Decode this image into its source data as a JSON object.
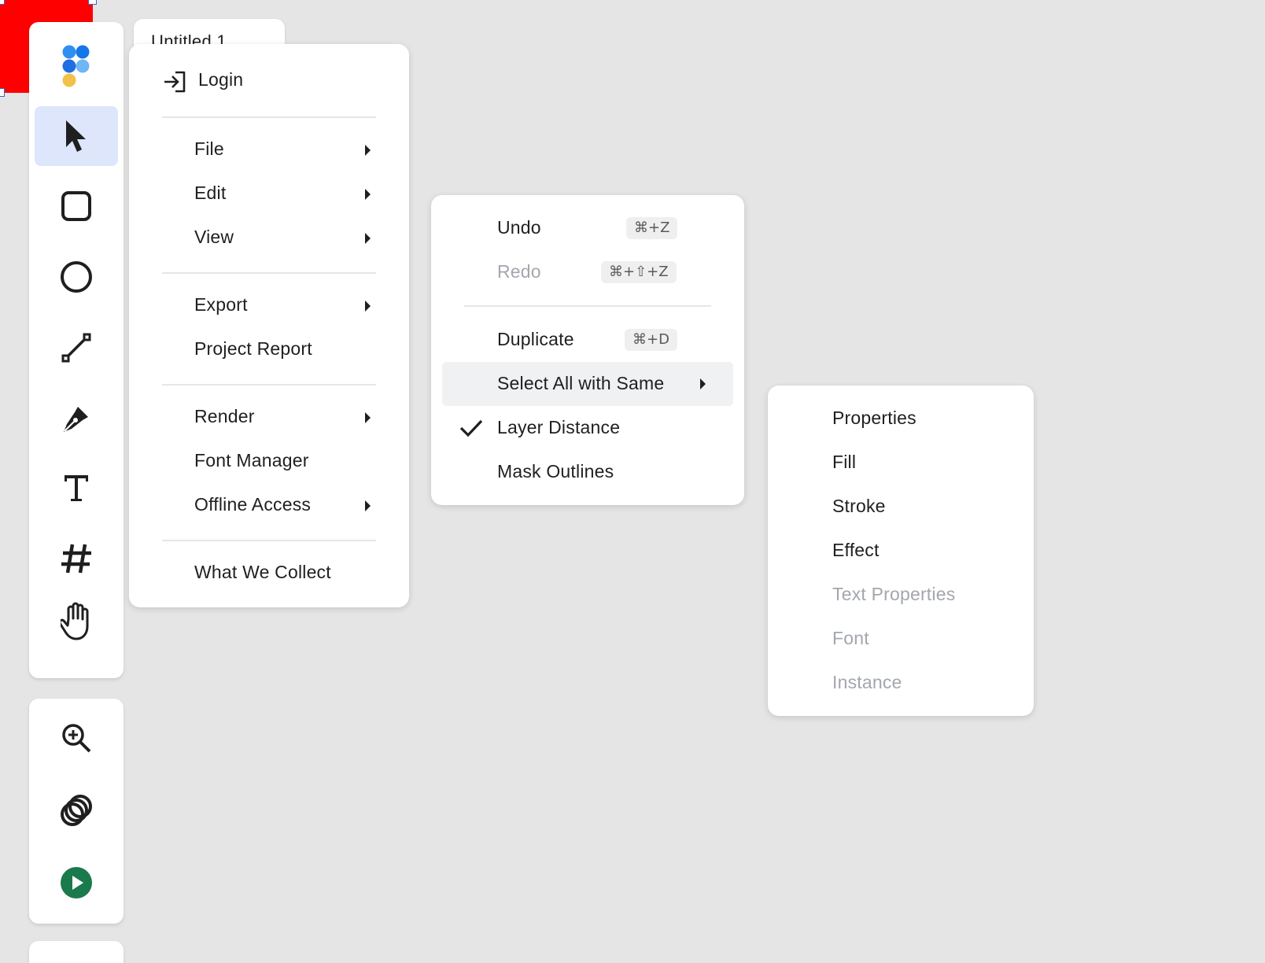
{
  "document": {
    "tab_title": "Untitled 1"
  },
  "canvas": {
    "selected_shape_color": "#ff0000"
  },
  "toolbar": {
    "tools": [
      {
        "name": "logo",
        "icon": "app-logo-icon"
      },
      {
        "name": "move",
        "icon": "cursor-arrow-icon",
        "active": true
      },
      {
        "name": "rectangle",
        "icon": "rectangle-icon"
      },
      {
        "name": "ellipse",
        "icon": "circle-icon"
      },
      {
        "name": "line",
        "icon": "line-icon"
      },
      {
        "name": "pen",
        "icon": "pen-nib-icon"
      },
      {
        "name": "text",
        "icon": "text-icon"
      },
      {
        "name": "frame",
        "icon": "hash-icon"
      },
      {
        "name": "hand",
        "icon": "hand-icon"
      }
    ],
    "secondary_tools": [
      {
        "name": "zoom",
        "icon": "zoom-in-icon"
      },
      {
        "name": "boolean",
        "icon": "overlap-circles-icon"
      },
      {
        "name": "present",
        "icon": "play-icon",
        "color": "#1a7a4c"
      }
    ]
  },
  "main_menu": {
    "login": "Login",
    "items": {
      "file": "File",
      "edit": "Edit",
      "view": "View",
      "export": "Export",
      "project_report": "Project Report",
      "render": "Render",
      "font_manager": "Font Manager",
      "offline_access": "Offline Access",
      "what_we_collect": "What We Collect"
    }
  },
  "edit_menu": {
    "undo": {
      "label": "Undo",
      "shortcut": "⌘+Z"
    },
    "redo": {
      "label": "Redo",
      "shortcut": "⌘+⇧+Z",
      "disabled": true
    },
    "duplicate": {
      "label": "Duplicate",
      "shortcut": "⌘+D"
    },
    "select_all_same": {
      "label": "Select All with Same",
      "highlighted": true
    },
    "layer_distance": {
      "label": "Layer Distance",
      "checked": true
    },
    "mask_outlines": {
      "label": "Mask Outlines"
    }
  },
  "select_same_menu": {
    "properties": "Properties",
    "fill": "Fill",
    "stroke": "Stroke",
    "effect": "Effect",
    "text_properties": "Text Properties",
    "font": "Font",
    "instance": "Instance",
    "disabled_items": [
      "Text Properties",
      "Font",
      "Instance"
    ]
  },
  "colors": {
    "active_tool_bg": "#dde6fb",
    "hover_row_bg": "#f0f1f3",
    "disabled_text": "#a3a7ad",
    "selection_handle": "#3a62d8"
  }
}
